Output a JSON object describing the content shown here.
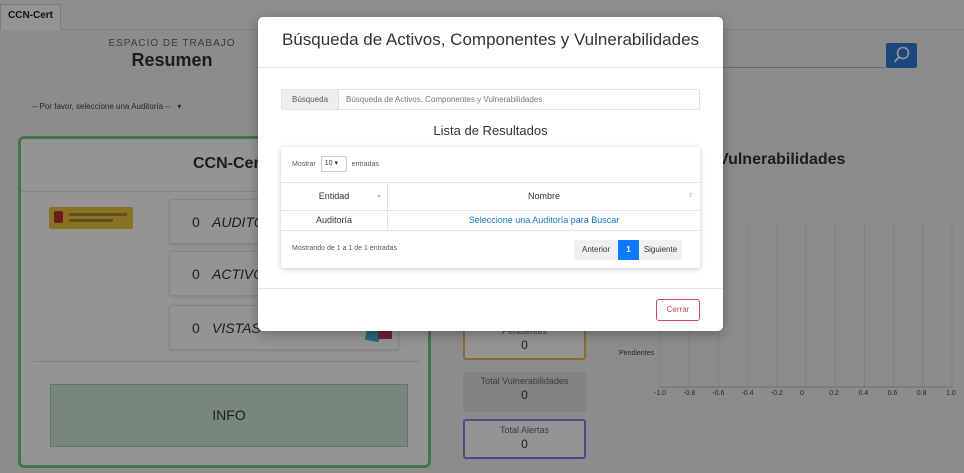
{
  "app": {
    "brand": "CCN-Cert"
  },
  "workspace": {
    "label": "ESPACIO DE TRABAJO",
    "title": "Resumen"
  },
  "audit_select": {
    "value": "-- Por favor, seleccione una Auditoría --"
  },
  "left_panel": {
    "title": "CCN-Cert",
    "stats": [
      {
        "value": "0",
        "label": "AUDITORÍAS"
      },
      {
        "value": "0",
        "label": "ACTIVOS"
      },
      {
        "value": "0",
        "label": "VISTAS"
      }
    ],
    "info_label": "INFO"
  },
  "mini_stats": {
    "pending": {
      "label": "Pendientes",
      "value": "0"
    },
    "total_vuln": {
      "label": "Total Vulnerabilidades",
      "value": "0"
    },
    "total_alerts": {
      "label": "Total Alertas",
      "value": "0"
    }
  },
  "right_panel": {
    "title": "Vulnerabilidades"
  },
  "chart_data": {
    "type": "bar",
    "categories": [
      "Pendientes"
    ],
    "values": [
      0
    ],
    "xlim": [
      -1.0,
      1.0
    ],
    "x_ticks": [
      "-1.0",
      "-0.8",
      "-0.6",
      "-0.4",
      "-0.2",
      "0",
      "0.2",
      "0.4",
      "0.6",
      "0.8",
      "1.0"
    ],
    "grid": true,
    "orientation": "horizontal"
  },
  "modal": {
    "title": "Búsqueda de Activos, Componentes y Vulnerabilidades",
    "search_addon": "Búsqueda",
    "search_placeholder": "Búsqueda de Activos, Componentes y Vulnerabilidades",
    "results_title": "Lista de Resultados",
    "show_prefix": "Mostrar",
    "show_value": "10",
    "show_suffix": "entradas",
    "columns": [
      "Entidad",
      "Nombre"
    ],
    "rows": [
      {
        "entidad": "Auditoría",
        "nombre": "Seleccione una Auditoría para Buscar"
      }
    ],
    "info_text": "Mostrando de 1 a 1 de 1 entradas",
    "pagination": {
      "prev": "Anterior",
      "current": "1",
      "next": "Siguiente"
    },
    "close_label": "Cerrar"
  },
  "colors": {
    "accent_blue": "#0a7bff",
    "search_button": "#2f7dd6",
    "panel_green": "#7cc47c",
    "pending_orange": "#f2b552",
    "alerts_purple": "#8a7bd6",
    "close_red": "#c94a57"
  }
}
